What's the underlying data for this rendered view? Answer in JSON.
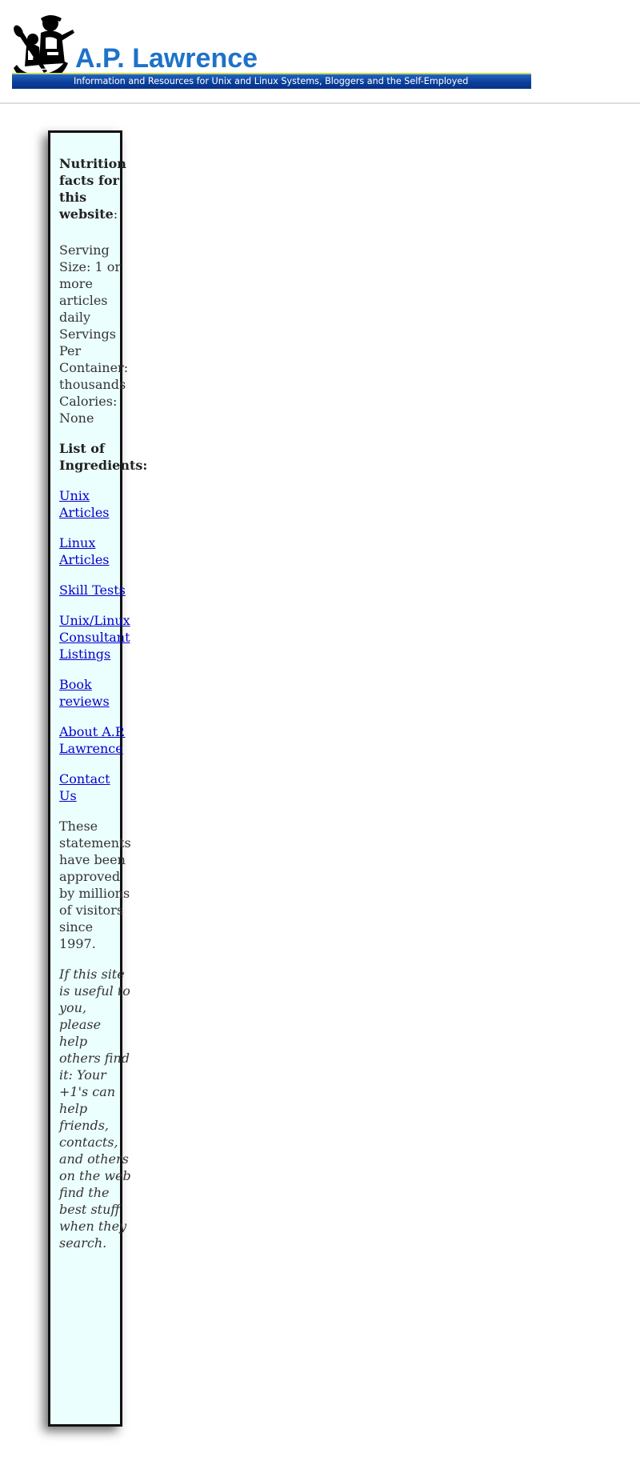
{
  "header": {
    "logo_icon": "canoe-paddler-logo",
    "site_title": "A.P. Lawrence",
    "tagline": "Information and Resources for Unix and Linux Systems, Bloggers and the Self-Employed",
    "accent_color": "#1e72c8",
    "bar_color": "#0b3f9a"
  },
  "sidebar": {
    "nutrition_heading": "Nutrition facts for this website",
    "nutrition_colon": ":",
    "serving_size": "Serving Size: 1 or more articles daily",
    "servings_per_container": "Servings Per Container: thousands",
    "calories": "Calories: None",
    "ingredients_heading": "List of Ingredients:",
    "links": [
      {
        "label": "Unix Articles"
      },
      {
        "label": "Linux Articles"
      },
      {
        "label": "Skill Tests"
      },
      {
        "label": "Unix/Linux Consultant Listings"
      },
      {
        "label": "Book reviews"
      },
      {
        "label": "About A.P. Lawrence"
      },
      {
        "label": "Contact Us"
      }
    ],
    "approved_statement": "These statements have been approved by millions of visitors since 1997.",
    "plus_one_note": "If this site is useful to you, please help others find it: Your +1's can help friends, contacts, and others on the web find the best stuff when they search.",
    "background_color": "#ecffff"
  }
}
